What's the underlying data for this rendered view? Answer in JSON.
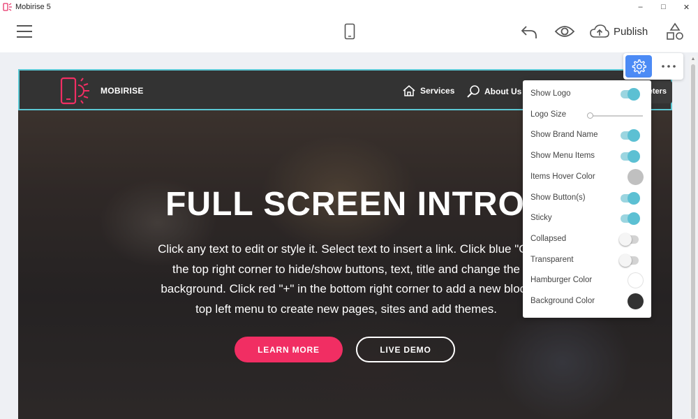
{
  "window": {
    "title": "Mobirise 5",
    "controls": [
      "–",
      "□",
      "✕"
    ]
  },
  "toolbar": {
    "menu_icon": "hamburger-icon",
    "device_icon": "mobile-phone-icon",
    "undo_icon": "undo-icon",
    "preview_icon": "eye-icon",
    "publish_label": "Publish",
    "blocks_icon": "shapes-icon"
  },
  "site": {
    "brand_name": "MOBIRISE",
    "nav": [
      {
        "label": "Services",
        "icon": "home-icon"
      },
      {
        "label": "About Us",
        "icon": "search-icon"
      }
    ],
    "nav_button_partial": "eters",
    "hero_title": "FULL SCREEN INTRO",
    "hero_lines": [
      "Click any text to edit or style it. Select text to insert a link. Click blue \"Ge",
      "the top right corner to hide/show buttons, text, title and change the",
      "background. Click red \"+\" in the bottom right corner to add a new block",
      "top left menu to create new pages, sites and add themes."
    ],
    "learn_more": "LEARN MORE",
    "live_demo": "LIVE DEMO"
  },
  "colors": {
    "accent_blue": "#4c8bf5",
    "toggle_on": "#5cc0d3",
    "cta_red": "#f12e63",
    "nav_bg": "#333333",
    "selection_outline": "#5cc8d4"
  },
  "panel": {
    "items": [
      {
        "label": "Show Logo",
        "control": "toggle",
        "on": true
      },
      {
        "label": "Logo Size",
        "control": "slider",
        "value": 0
      },
      {
        "label": "Show Brand Name",
        "control": "toggle",
        "on": true
      },
      {
        "label": "Show Menu Items",
        "control": "toggle",
        "on": true
      },
      {
        "label": "Items Hover Color",
        "control": "swatch",
        "color": "#c0c0c0"
      },
      {
        "label": "Show Button(s)",
        "control": "toggle",
        "on": true
      },
      {
        "label": "Sticky",
        "control": "toggle",
        "on": true
      },
      {
        "label": "Collapsed",
        "control": "toggle",
        "on": false
      },
      {
        "label": "Transparent",
        "control": "toggle",
        "on": false
      },
      {
        "label": "Hamburger Color",
        "control": "swatch",
        "color": "#ffffff"
      },
      {
        "label": "Background Color",
        "control": "swatch",
        "color": "#333333"
      }
    ]
  }
}
